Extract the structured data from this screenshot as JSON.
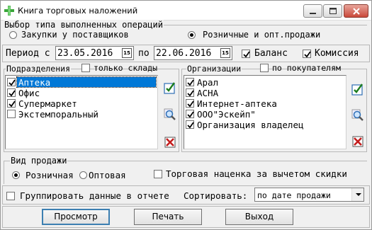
{
  "window": {
    "title": "Книга торговых наложений"
  },
  "operation_type": {
    "legend": "Выбор типа выполненных операций",
    "options": [
      {
        "label": "Закупки у поставщиков",
        "selected": false
      },
      {
        "label": "Розничные и опт.продажи",
        "selected": true
      }
    ]
  },
  "period": {
    "label_from": "Период с",
    "date_from": "23.05.2016",
    "label_to": "по",
    "date_to": "22.06.2016",
    "calendar_icon_text": "15"
  },
  "balance": {
    "label": "Баланс",
    "checked": true
  },
  "commission": {
    "label": "Комиссия",
    "checked": true
  },
  "departments": {
    "legend": "Подразделения",
    "only_warehouses": {
      "label": "только склады",
      "checked": false
    },
    "items": [
      {
        "label": "Аптека",
        "checked": true,
        "selected": true
      },
      {
        "label": "Офис",
        "checked": true,
        "selected": false
      },
      {
        "label": "Супермаркет",
        "checked": true,
        "selected": false
      },
      {
        "label": "Экстемпоральный",
        "checked": false,
        "selected": false
      }
    ]
  },
  "organizations": {
    "legend": "Организации",
    "by_buyers": {
      "label": "по покупателям",
      "checked": false
    },
    "items": [
      {
        "label": "Арал",
        "checked": true
      },
      {
        "label": "АСНА",
        "checked": true
      },
      {
        "label": "Интернет-аптека",
        "checked": true
      },
      {
        "label": "ООО\"Эскейп\"",
        "checked": true
      },
      {
        "label": "Организация владелец",
        "checked": true
      }
    ]
  },
  "sale_type": {
    "legend": "Вид продажи",
    "options": [
      {
        "label": "Розничная",
        "selected": true
      },
      {
        "label": "Оптовая",
        "selected": false
      }
    ]
  },
  "markup_net_discount": {
    "label": "Торговая наценка за вычетом скидки",
    "checked": false
  },
  "group_data": {
    "label": "Группировать данные в отчете",
    "checked": false
  },
  "sort": {
    "label": "Сортировать:",
    "value": "по дате продажи"
  },
  "buttons": {
    "preview": "Просмотр",
    "print": "Печать",
    "exit": "Выход"
  }
}
